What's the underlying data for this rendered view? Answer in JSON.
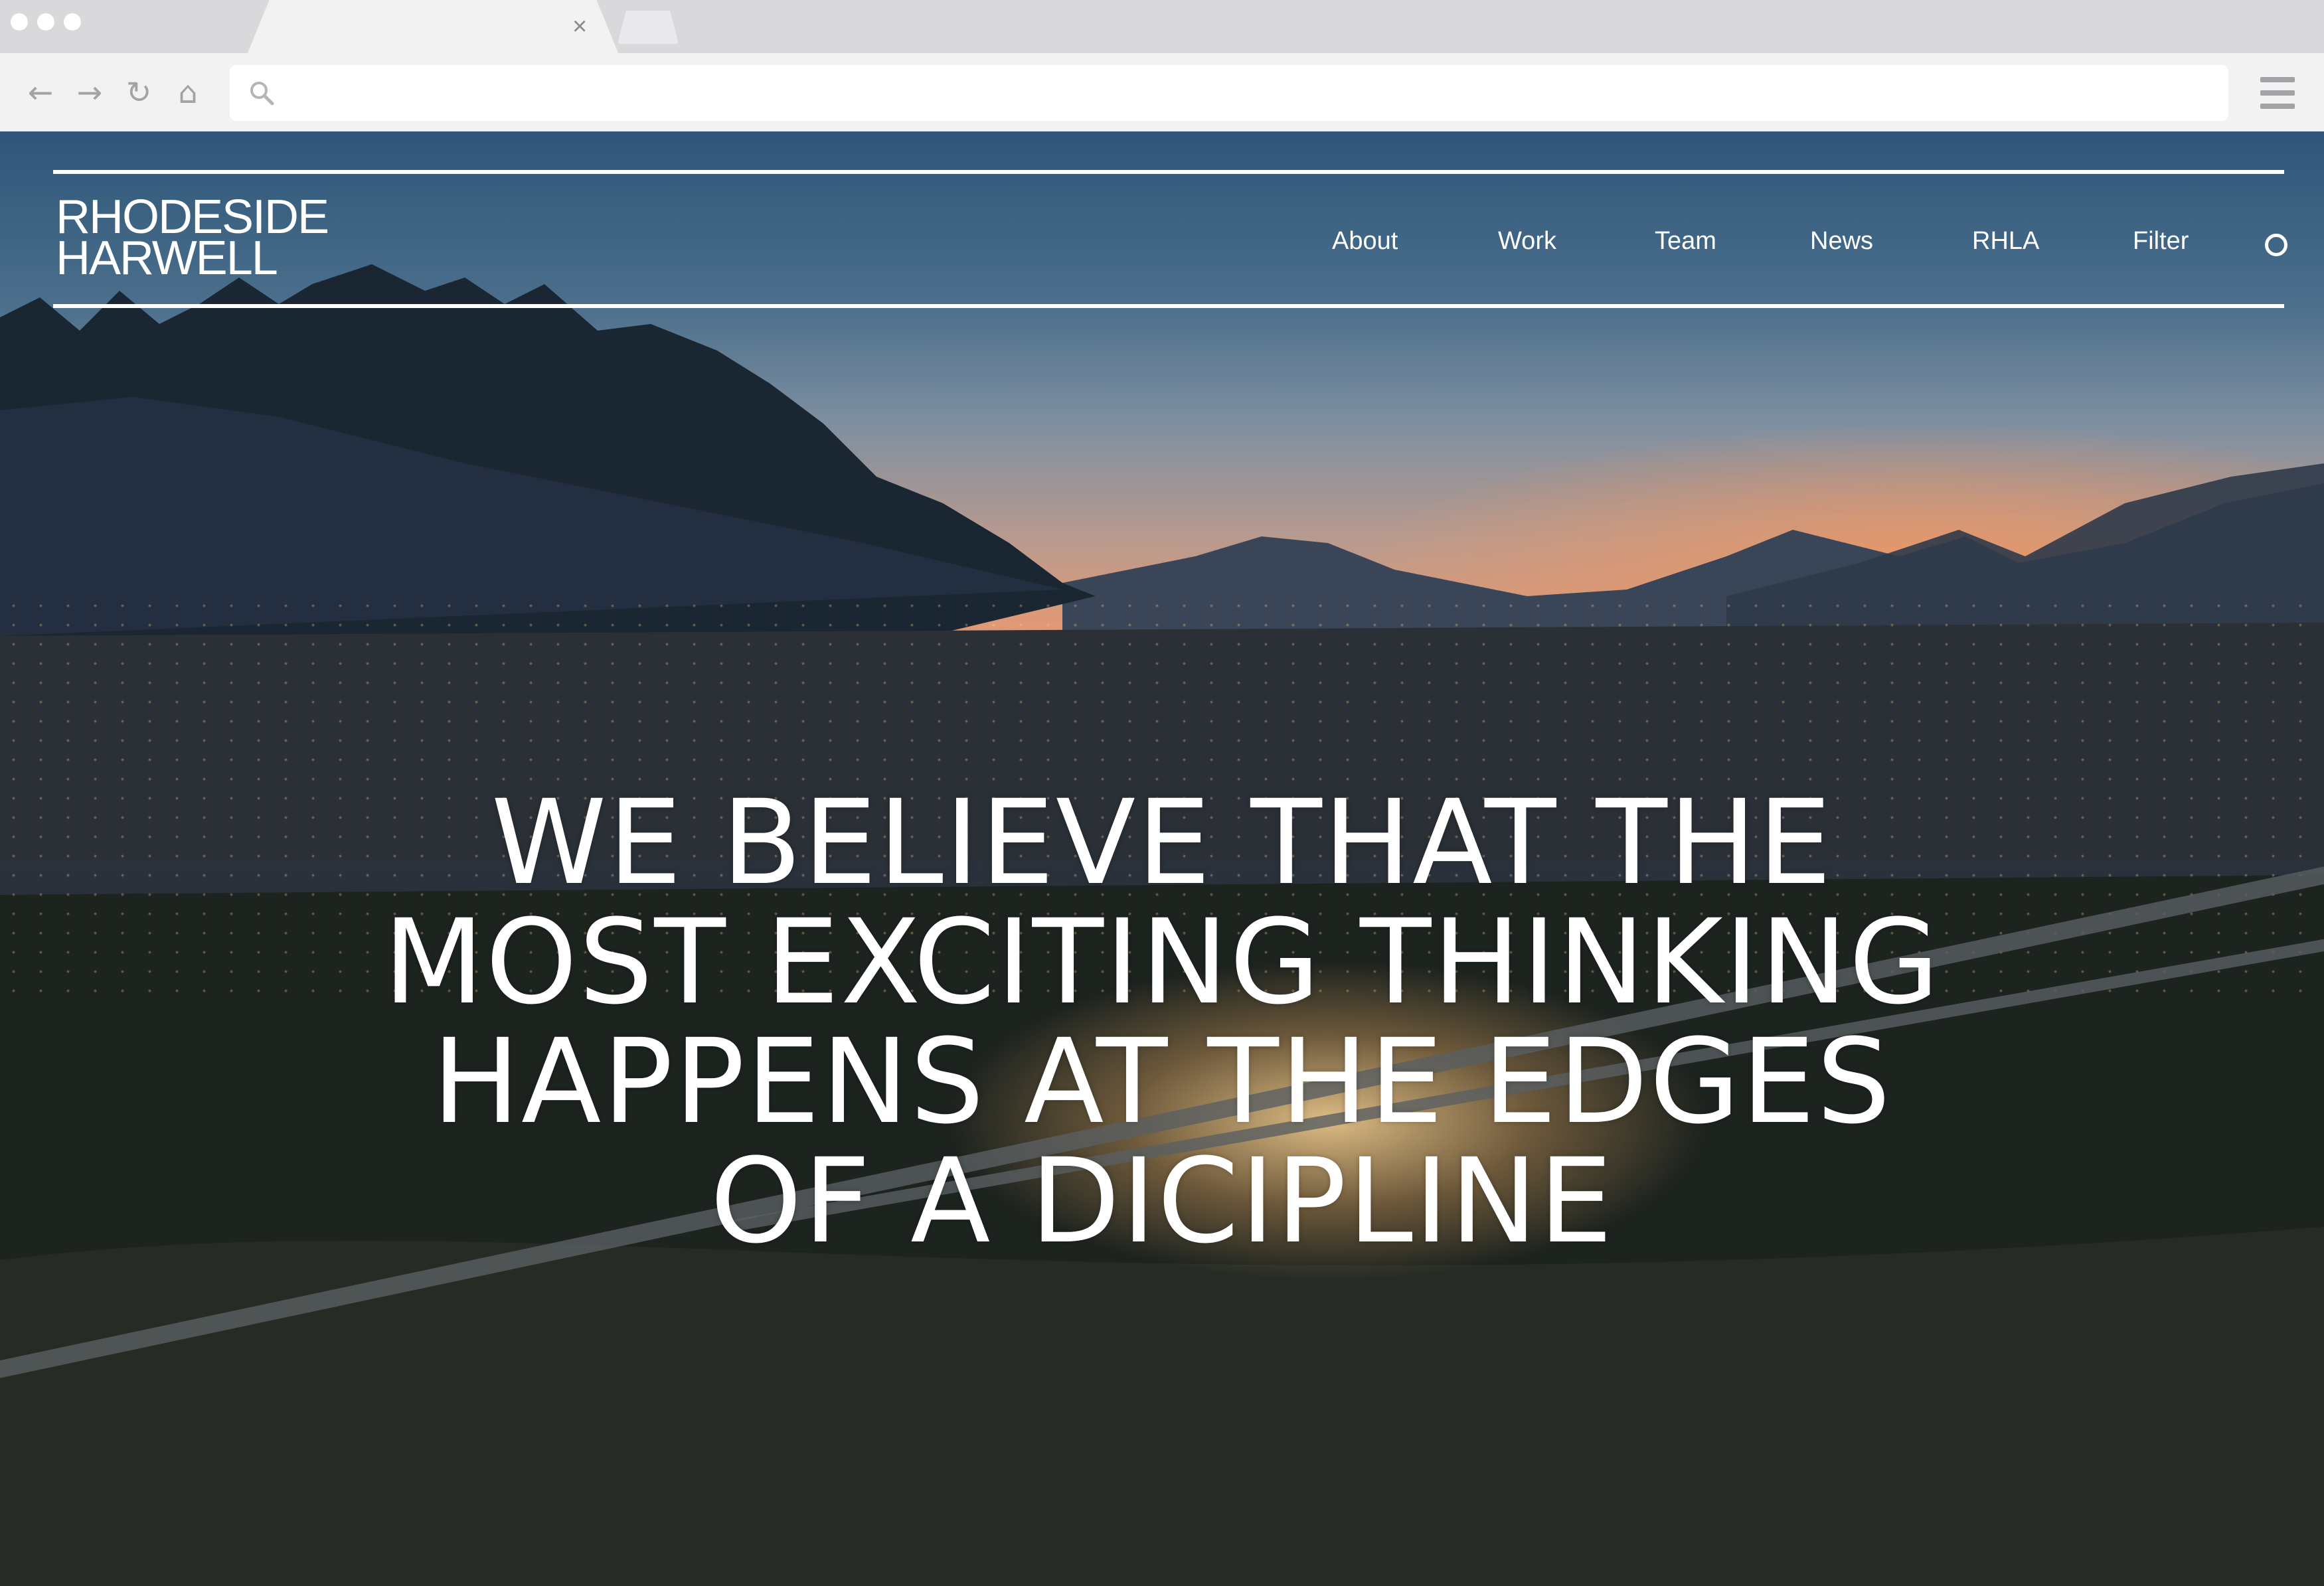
{
  "browser": {
    "tab_close_glyph": "×",
    "url": "",
    "nav": {
      "back_glyph": "←",
      "forward_glyph": "→",
      "reload_glyph": "↻",
      "home_glyph": "⌂"
    }
  },
  "site": {
    "logo": {
      "line1": "RHODESIDE",
      "line2": "HARWELL"
    },
    "nav_items": [
      "About",
      "Work",
      "Team",
      "News",
      "RHLA",
      "Filter"
    ],
    "search_icon": "search-circle-icon"
  },
  "hero": {
    "headline_lines": [
      "WE BELIEVE THAT THE",
      "MOST EXCITING THINKING",
      "HAPPENS AT THE EDGES",
      "OF A DICIPLINE"
    ]
  },
  "colors": {
    "chrome_bg": "#f2f2f3",
    "tabstrip_bg": "#d9d9db",
    "text_on_hero": "#ffffff"
  }
}
